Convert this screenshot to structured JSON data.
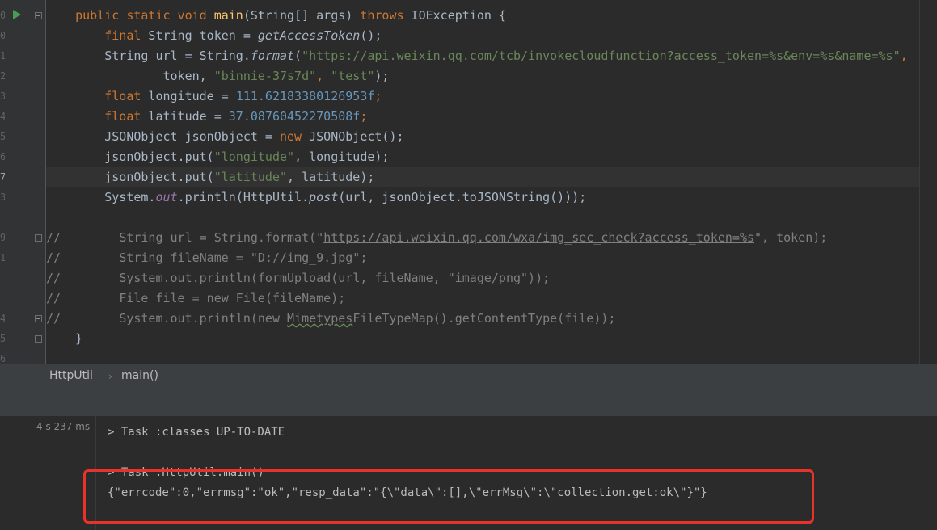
{
  "editor": {
    "line_numbers": [
      "0",
      "0",
      "1",
      "2",
      "3",
      "4",
      "5",
      "6",
      "7",
      "3",
      "",
      "9",
      "1",
      "",
      "",
      "4",
      "5",
      "6"
    ],
    "lines": {
      "l0": {
        "a": "public",
        "b": " static",
        "c": " void ",
        "d": "main",
        "e": "(String[] args) ",
        "f": "throws",
        "g": " IOException {"
      },
      "l1": {
        "a": "final",
        "b": " String token = ",
        "c": "getAccessToken",
        "d": "();"
      },
      "l2": {
        "a": "String url = String.",
        "b": "format",
        "c": "(",
        "d": "\"",
        "e": "https://api.weixin.qq.com/tcb/invokecloudfunction?access_token=%s&env=%s&name=%s",
        "f": "\"",
        ",": ","
      },
      "l3": {
        "a": "token, ",
        "b": "\"binnie-37s7d\"",
        "c": ", ",
        "d": "\"test\"",
        "e": ");"
      },
      "l4": {
        "a": "float",
        "b": " longitude = ",
        "c": "111.62183380126953f",
        "d": ";"
      },
      "l5": {
        "a": "float",
        "b": " latitude = ",
        "c": "37.08760452270508f",
        "d": ";"
      },
      "l6": {
        "a": "JSONObject jsonObject = ",
        "b": "new",
        "c": " JSONObject();"
      },
      "l7": {
        "a": "jsonObject.put(",
        "b": "\"longitude\"",
        "c": ", longitude);"
      },
      "l8": {
        "a": "jsonObject.put(",
        "b": "\"latitude\"",
        "c": ", latitude);"
      },
      "l9": {
        "a": "System.",
        "b": "out",
        "c": ".println(HttpUtil.",
        "d": "post",
        "e": "(url, jsonObject.toJSONString()));"
      },
      "c1": {
        "a": "//",
        "b": "String url = String.format(\"",
        "c": "https://api.weixin.qq.com/wxa/img_sec_check?access_token=%s",
        "d": "\", token);"
      },
      "c2": {
        "a": "//",
        "b": "String fileName = \"D://img_9.jpg\";"
      },
      "c3": {
        "a": "//",
        "b": "System.out.println(formUpload(url, fileName, \"image/png\"));"
      },
      "c4": {
        "a": "//",
        "b": "File file = new File(fileName);"
      },
      "c5": {
        "a": "//",
        "b": "System.out.println(new ",
        "c": "Mimetypes",
        "d": "FileTypeMap().getContentType(file));"
      },
      "close": "}"
    }
  },
  "breadcrumb": {
    "class_name": "HttpUtil",
    "sep": "›",
    "method": "main()"
  },
  "run": {
    "elapsed": "4 s 237 ms",
    "lines": {
      "classes": "> Task :classes UP-TO-DATE",
      "main": "> Task :HttpUtil.main()",
      "output": "{\"errcode\":0,\"errmsg\":\"ok\",\"resp_data\":\"{\\\"data\\\":[],\\\"errMsg\\\":\\\"collection.get:ok\\\"}\"}"
    }
  },
  "colors": {
    "keyword": "#cc7832",
    "string": "#6a8759",
    "number": "#6897bb",
    "method": "#ffc66d",
    "highlight_box": "#e8322a"
  }
}
